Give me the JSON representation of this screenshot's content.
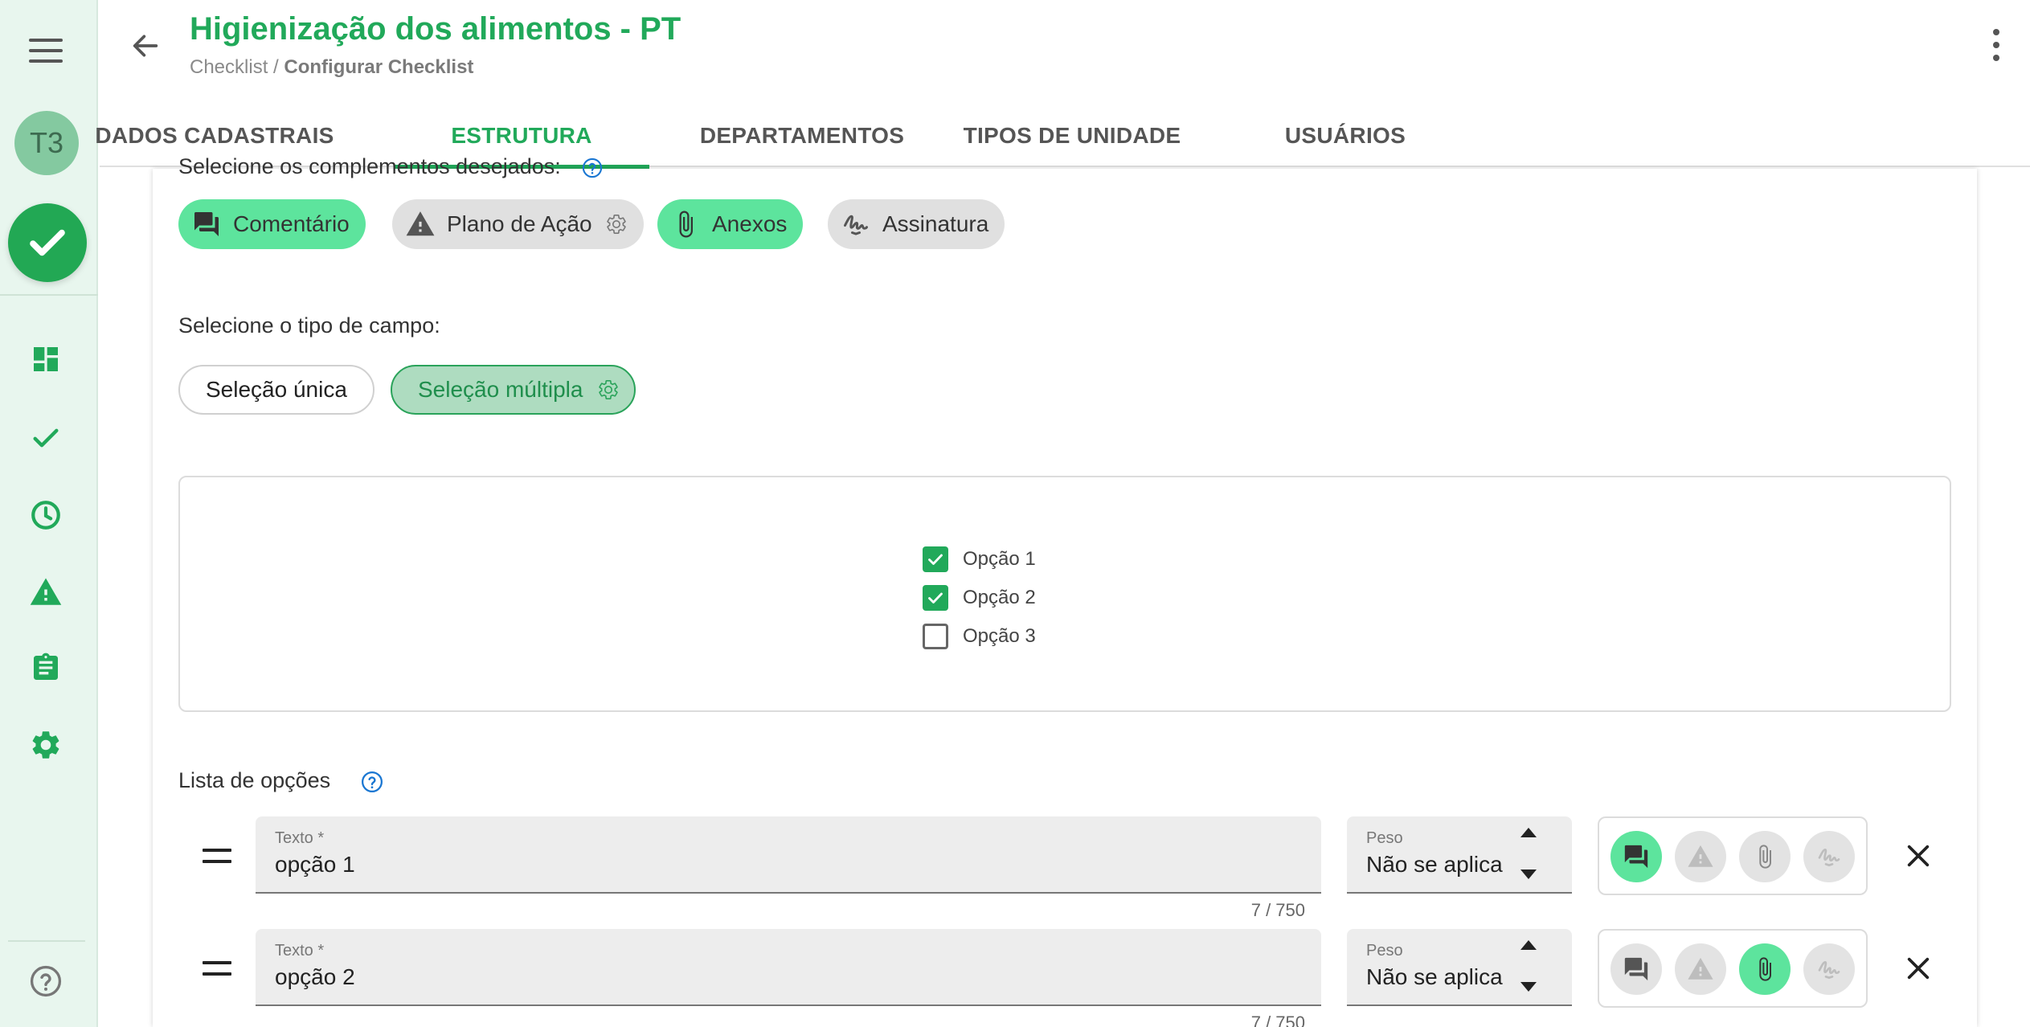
{
  "sidebar": {
    "avatar_initials": "T3",
    "items": [
      {
        "name": "dashboard-icon"
      },
      {
        "name": "check-icon"
      },
      {
        "name": "clock-icon"
      },
      {
        "name": "warning-icon"
      },
      {
        "name": "clipboard-icon"
      },
      {
        "name": "gear-icon"
      }
    ]
  },
  "header": {
    "title": "Higienização dos alimentos - PT",
    "breadcrumb_root": "Checklist",
    "breadcrumb_sep": " / ",
    "breadcrumb_current": "Configurar Checklist"
  },
  "tabs": [
    {
      "label": "DADOS CADASTRAIS",
      "active": false
    },
    {
      "label": "ESTRUTURA",
      "active": true
    },
    {
      "label": "DEPARTAMENTOS",
      "active": false
    },
    {
      "label": "TIPOS DE UNIDADE",
      "active": false
    },
    {
      "label": "USUÁRIOS",
      "active": false
    }
  ],
  "complements": {
    "label": "Selecione os complementos desejados:",
    "chips": [
      {
        "label": "Comentário",
        "selected": true
      },
      {
        "label": "Plano de Ação",
        "selected": false
      },
      {
        "label": "Anexos",
        "selected": true
      },
      {
        "label": "Assinatura",
        "selected": false
      }
    ]
  },
  "field_type": {
    "label": "Selecione o tipo de campo:",
    "options": [
      {
        "label": "Seleção única",
        "selected": false
      },
      {
        "label": "Seleção múltipla",
        "selected": true
      }
    ]
  },
  "preview": {
    "options": [
      {
        "label": "Opção 1",
        "checked": true
      },
      {
        "label": "Opção 2",
        "checked": true
      },
      {
        "label": "Opção 3",
        "checked": false
      }
    ]
  },
  "options_list": {
    "label": "Lista de opções",
    "rows": [
      {
        "text_label": "Texto *",
        "text_value": "opção 1",
        "counter": "7 / 750",
        "weight_label": "Peso",
        "weight_value": "Não se aplica",
        "complements": [
          true,
          false,
          false,
          false
        ]
      },
      {
        "text_label": "Texto *",
        "text_value": "opção 2",
        "counter": "7 / 750",
        "weight_label": "Peso",
        "weight_value": "Não se aplica",
        "complements": [
          false,
          false,
          true,
          false
        ]
      }
    ]
  },
  "colors": {
    "primary": "#21a95a",
    "chip_on": "#5de49d",
    "chip_off": "#e0e0e0",
    "sidebar_bg": "#e8f6ee",
    "help_blue": "#1976d2"
  }
}
